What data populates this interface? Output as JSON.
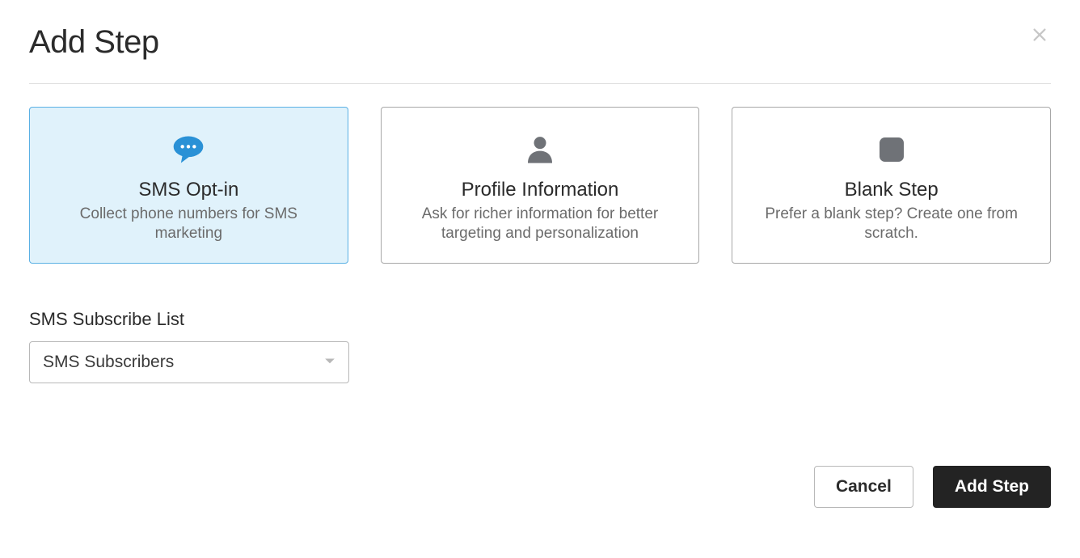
{
  "modal": {
    "title": "Add Step"
  },
  "cards": [
    {
      "title": "SMS Opt-in",
      "desc": "Collect phone numbers for SMS marketing"
    },
    {
      "title": "Profile Information",
      "desc": "Ask for richer information for better targeting and personalization"
    },
    {
      "title": "Blank Step",
      "desc": "Prefer a blank step? Create one from scratch."
    }
  ],
  "subscribe": {
    "label": "SMS Subscribe List",
    "selected": "SMS Subscribers"
  },
  "actions": {
    "cancel": "Cancel",
    "confirm": "Add Step"
  }
}
